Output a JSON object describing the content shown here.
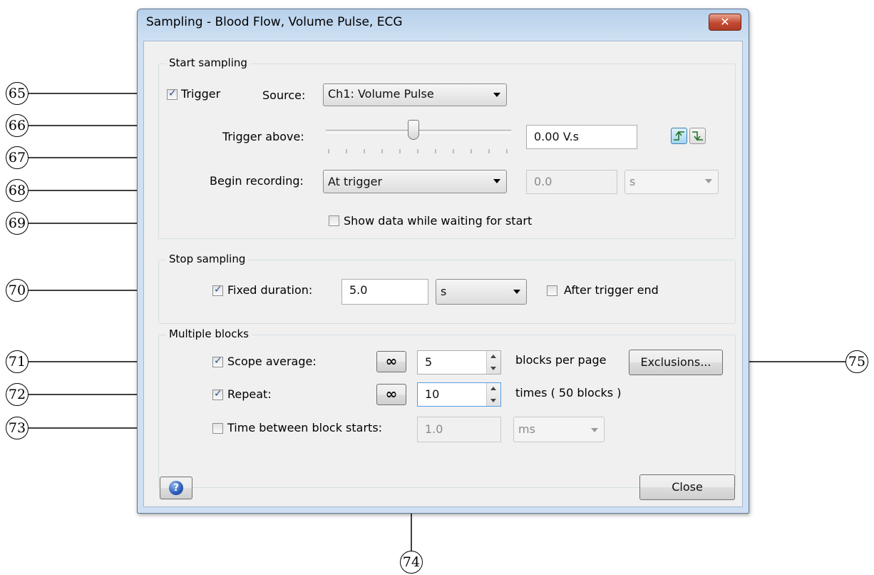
{
  "window": {
    "title": "Sampling - Blood Flow, Volume Pulse, ECG"
  },
  "start_sampling": {
    "group_label": "Start sampling",
    "trigger": {
      "label": "Trigger",
      "checked": true
    },
    "source": {
      "label": "Source:",
      "value": "Ch1: Volume Pulse"
    },
    "trigger_above": {
      "label": "Trigger above:",
      "value": "0.00 V.s",
      "slider_position": 0.53
    },
    "begin_recording": {
      "label": "Begin recording:",
      "value": "At trigger",
      "delay_value": "0.0",
      "delay_unit": "s"
    },
    "show_data": {
      "label": "Show data while waiting for start",
      "checked": false
    }
  },
  "stop_sampling": {
    "group_label": "Stop sampling",
    "fixed_duration": {
      "label": "Fixed duration:",
      "checked": true,
      "value": "5.0",
      "unit": "s"
    },
    "after_trigger_end": {
      "label": "After trigger end",
      "checked": false
    }
  },
  "multiple_blocks": {
    "group_label": "Multiple blocks",
    "scope_average": {
      "label": "Scope average:",
      "checked": true,
      "value": "5",
      "suffix": "blocks per page",
      "infinity": "∞"
    },
    "exclusions_button": "Exclusions...",
    "repeat": {
      "label": "Repeat:",
      "checked": true,
      "value": "10",
      "suffix": "times ( 50 blocks )",
      "infinity": "∞"
    },
    "time_between": {
      "label": "Time between block starts:",
      "checked": false,
      "value": "1.0",
      "unit": "ms"
    }
  },
  "footer": {
    "help_icon": "?",
    "close_button": "Close"
  },
  "callouts": {
    "c65": "65",
    "c66": "66",
    "c67": "67",
    "c68": "68",
    "c69": "69",
    "c70": "70",
    "c71": "71",
    "c72": "72",
    "c73": "73",
    "c74": "74",
    "c75": "75"
  },
  "colors": {
    "titlebar": "#b7d1ec",
    "close_red": "#c24a34",
    "client_bg": "#f0f0f0"
  }
}
